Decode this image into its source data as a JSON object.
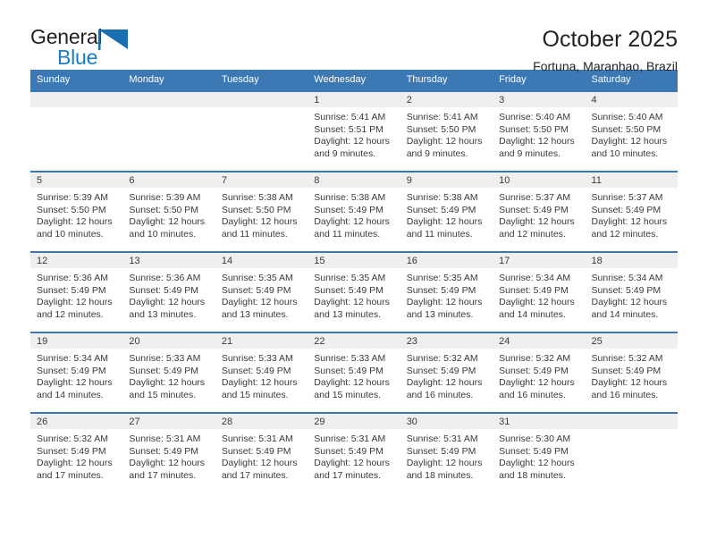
{
  "brand": {
    "name_top": "General",
    "name_bottom": "Blue",
    "accent_color": "#1a7dc4",
    "logo_icon": "triangle-flag-icon"
  },
  "header": {
    "title": "October 2025",
    "subtitle": "Fortuna, Maranhao, Brazil"
  },
  "calendar": {
    "header_bg": "#3c78b4",
    "daynum_bg": "#efefef",
    "weekday_headers": [
      "Sunday",
      "Monday",
      "Tuesday",
      "Wednesday",
      "Thursday",
      "Friday",
      "Saturday"
    ],
    "weeks": [
      [
        {
          "day": "",
          "sunrise": "",
          "sunset": "",
          "daylight": "",
          "empty": true
        },
        {
          "day": "",
          "sunrise": "",
          "sunset": "",
          "daylight": "",
          "empty": true
        },
        {
          "day": "",
          "sunrise": "",
          "sunset": "",
          "daylight": "",
          "empty": true
        },
        {
          "day": "1",
          "sunrise": "Sunrise: 5:41 AM",
          "sunset": "Sunset: 5:51 PM",
          "daylight": "Daylight: 12 hours and 9 minutes."
        },
        {
          "day": "2",
          "sunrise": "Sunrise: 5:41 AM",
          "sunset": "Sunset: 5:50 PM",
          "daylight": "Daylight: 12 hours and 9 minutes."
        },
        {
          "day": "3",
          "sunrise": "Sunrise: 5:40 AM",
          "sunset": "Sunset: 5:50 PM",
          "daylight": "Daylight: 12 hours and 9 minutes."
        },
        {
          "day": "4",
          "sunrise": "Sunrise: 5:40 AM",
          "sunset": "Sunset: 5:50 PM",
          "daylight": "Daylight: 12 hours and 10 minutes."
        }
      ],
      [
        {
          "day": "5",
          "sunrise": "Sunrise: 5:39 AM",
          "sunset": "Sunset: 5:50 PM",
          "daylight": "Daylight: 12 hours and 10 minutes."
        },
        {
          "day": "6",
          "sunrise": "Sunrise: 5:39 AM",
          "sunset": "Sunset: 5:50 PM",
          "daylight": "Daylight: 12 hours and 10 minutes."
        },
        {
          "day": "7",
          "sunrise": "Sunrise: 5:38 AM",
          "sunset": "Sunset: 5:50 PM",
          "daylight": "Daylight: 12 hours and 11 minutes."
        },
        {
          "day": "8",
          "sunrise": "Sunrise: 5:38 AM",
          "sunset": "Sunset: 5:49 PM",
          "daylight": "Daylight: 12 hours and 11 minutes."
        },
        {
          "day": "9",
          "sunrise": "Sunrise: 5:38 AM",
          "sunset": "Sunset: 5:49 PM",
          "daylight": "Daylight: 12 hours and 11 minutes."
        },
        {
          "day": "10",
          "sunrise": "Sunrise: 5:37 AM",
          "sunset": "Sunset: 5:49 PM",
          "daylight": "Daylight: 12 hours and 12 minutes."
        },
        {
          "day": "11",
          "sunrise": "Sunrise: 5:37 AM",
          "sunset": "Sunset: 5:49 PM",
          "daylight": "Daylight: 12 hours and 12 minutes."
        }
      ],
      [
        {
          "day": "12",
          "sunrise": "Sunrise: 5:36 AM",
          "sunset": "Sunset: 5:49 PM",
          "daylight": "Daylight: 12 hours and 12 minutes."
        },
        {
          "day": "13",
          "sunrise": "Sunrise: 5:36 AM",
          "sunset": "Sunset: 5:49 PM",
          "daylight": "Daylight: 12 hours and 13 minutes."
        },
        {
          "day": "14",
          "sunrise": "Sunrise: 5:35 AM",
          "sunset": "Sunset: 5:49 PM",
          "daylight": "Daylight: 12 hours and 13 minutes."
        },
        {
          "day": "15",
          "sunrise": "Sunrise: 5:35 AM",
          "sunset": "Sunset: 5:49 PM",
          "daylight": "Daylight: 12 hours and 13 minutes."
        },
        {
          "day": "16",
          "sunrise": "Sunrise: 5:35 AM",
          "sunset": "Sunset: 5:49 PM",
          "daylight": "Daylight: 12 hours and 13 minutes."
        },
        {
          "day": "17",
          "sunrise": "Sunrise: 5:34 AM",
          "sunset": "Sunset: 5:49 PM",
          "daylight": "Daylight: 12 hours and 14 minutes."
        },
        {
          "day": "18",
          "sunrise": "Sunrise: 5:34 AM",
          "sunset": "Sunset: 5:49 PM",
          "daylight": "Daylight: 12 hours and 14 minutes."
        }
      ],
      [
        {
          "day": "19",
          "sunrise": "Sunrise: 5:34 AM",
          "sunset": "Sunset: 5:49 PM",
          "daylight": "Daylight: 12 hours and 14 minutes."
        },
        {
          "day": "20",
          "sunrise": "Sunrise: 5:33 AM",
          "sunset": "Sunset: 5:49 PM",
          "daylight": "Daylight: 12 hours and 15 minutes."
        },
        {
          "day": "21",
          "sunrise": "Sunrise: 5:33 AM",
          "sunset": "Sunset: 5:49 PM",
          "daylight": "Daylight: 12 hours and 15 minutes."
        },
        {
          "day": "22",
          "sunrise": "Sunrise: 5:33 AM",
          "sunset": "Sunset: 5:49 PM",
          "daylight": "Daylight: 12 hours and 15 minutes."
        },
        {
          "day": "23",
          "sunrise": "Sunrise: 5:32 AM",
          "sunset": "Sunset: 5:49 PM",
          "daylight": "Daylight: 12 hours and 16 minutes."
        },
        {
          "day": "24",
          "sunrise": "Sunrise: 5:32 AM",
          "sunset": "Sunset: 5:49 PM",
          "daylight": "Daylight: 12 hours and 16 minutes."
        },
        {
          "day": "25",
          "sunrise": "Sunrise: 5:32 AM",
          "sunset": "Sunset: 5:49 PM",
          "daylight": "Daylight: 12 hours and 16 minutes."
        }
      ],
      [
        {
          "day": "26",
          "sunrise": "Sunrise: 5:32 AM",
          "sunset": "Sunset: 5:49 PM",
          "daylight": "Daylight: 12 hours and 17 minutes."
        },
        {
          "day": "27",
          "sunrise": "Sunrise: 5:31 AM",
          "sunset": "Sunset: 5:49 PM",
          "daylight": "Daylight: 12 hours and 17 minutes."
        },
        {
          "day": "28",
          "sunrise": "Sunrise: 5:31 AM",
          "sunset": "Sunset: 5:49 PM",
          "daylight": "Daylight: 12 hours and 17 minutes."
        },
        {
          "day": "29",
          "sunrise": "Sunrise: 5:31 AM",
          "sunset": "Sunset: 5:49 PM",
          "daylight": "Daylight: 12 hours and 17 minutes."
        },
        {
          "day": "30",
          "sunrise": "Sunrise: 5:31 AM",
          "sunset": "Sunset: 5:49 PM",
          "daylight": "Daylight: 12 hours and 18 minutes."
        },
        {
          "day": "31",
          "sunrise": "Sunrise: 5:30 AM",
          "sunset": "Sunset: 5:49 PM",
          "daylight": "Daylight: 12 hours and 18 minutes."
        },
        {
          "day": "",
          "sunrise": "",
          "sunset": "",
          "daylight": "",
          "empty": true
        }
      ]
    ]
  }
}
